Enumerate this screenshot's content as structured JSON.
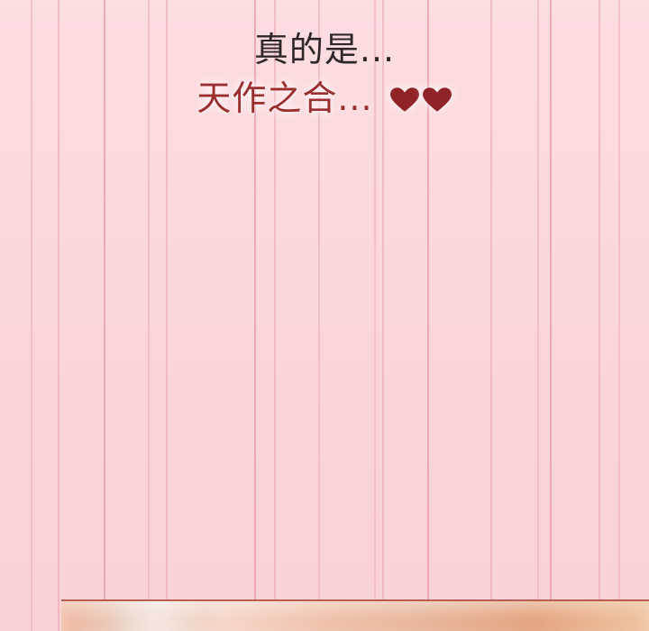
{
  "caption": {
    "line1": "真的是...",
    "line2": "天作之合..."
  },
  "colors": {
    "background": "#fbd9dc",
    "stripes": "#e59aaa",
    "line1": "#2e2728",
    "line2": "#9b2e2f",
    "heart": "#8f2327",
    "panel_border": "#b95f52"
  },
  "icons": {
    "heart_1": "heart-icon",
    "heart_2": "heart-icon"
  }
}
